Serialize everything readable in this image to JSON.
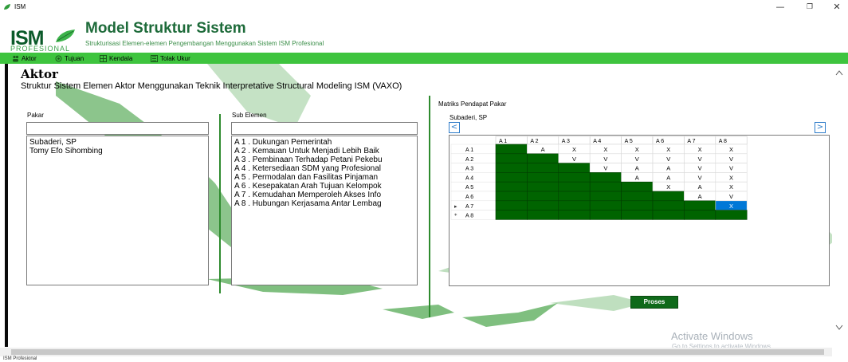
{
  "window": {
    "title": "ISM",
    "minimize": "—",
    "maximize": "❐",
    "close": "✕"
  },
  "header": {
    "logo": "ISM",
    "logo_sub": "PROFESIONAL",
    "title": "Model Struktur Sistem",
    "subtitle": "Strukturisasi Elemen-elemen Pengembangan Menggunakan Sistem ISM Profesional"
  },
  "menu": [
    {
      "label": "Aktor",
      "icon": "people-icon"
    },
    {
      "label": "Tujuan",
      "icon": "target-icon"
    },
    {
      "label": "Kendala",
      "icon": "grid-icon"
    },
    {
      "label": "Tolak Ukur",
      "icon": "ruler-icon"
    }
  ],
  "page": {
    "heading": "Aktor",
    "description": "Struktur Sistem Elemen Aktor  Menggunakan Teknik Interpretative Structural Modeling ISM (VAXO)"
  },
  "pakar": {
    "label": "Pakar",
    "search_value": "",
    "items": [
      "Subaderi, SP",
      "Tomy Efo Sihombing"
    ]
  },
  "sub_elemen": {
    "label": "Sub Elemen",
    "search_value": "",
    "items": [
      "A 1 . Dukungan Pemerintah",
      "A 2 . Kemauan Untuk Menjadi Lebih Baik",
      "A 3 . Pembinaan Terhadap Petani Pekebu",
      "A 4 . Ketersediaan SDM yang Profesional",
      "A 5 . Permodalan dan Fasilitas Pinjaman",
      "A 6 . Kesepakatan Arah Tujuan Kelompok",
      "A 7 . Kemudahan Memperoleh Akses Info",
      "A 8 . Hubungan Kerjasama Antar Lembag"
    ]
  },
  "matrix": {
    "label": "Matriks Pendapat Pakar",
    "expert": "Subaderi, SP",
    "prev": "<",
    "next": ">",
    "columns": [
      "A 1",
      "A 2",
      "A 3",
      "A 4",
      "A 5",
      "A 6",
      "A 7",
      "A 8"
    ],
    "rows": [
      {
        "marker": "",
        "label": "A 1",
        "cells": [
          "",
          "A",
          "X",
          "X",
          "X",
          "X",
          "X",
          "X"
        ]
      },
      {
        "marker": "",
        "label": "A 2",
        "cells": [
          "",
          "",
          "V",
          "V",
          "V",
          "V",
          "V",
          "V"
        ]
      },
      {
        "marker": "",
        "label": "A 3",
        "cells": [
          "",
          "",
          "",
          "V",
          "A",
          "A",
          "V",
          "V"
        ]
      },
      {
        "marker": "",
        "label": "A 4",
        "cells": [
          "",
          "",
          "",
          "",
          "A",
          "A",
          "V",
          "X"
        ]
      },
      {
        "marker": "",
        "label": "A 5",
        "cells": [
          "",
          "",
          "",
          "",
          "",
          "X",
          "A",
          "X"
        ]
      },
      {
        "marker": "",
        "label": "A 6",
        "cells": [
          "",
          "",
          "",
          "",
          "",
          "",
          "A",
          "V"
        ]
      },
      {
        "marker": "▸",
        "label": "A 7",
        "cells": [
          "",
          "",
          "",
          "",
          "",
          "",
          "",
          "X"
        ]
      },
      {
        "marker": "*",
        "label": "A 8",
        "cells": [
          "",
          "",
          "",
          "",
          "",
          "",
          "",
          ""
        ]
      }
    ],
    "selected": {
      "row": 6,
      "col": 7
    }
  },
  "proses_label": "Proses",
  "watermark": {
    "line1": "Activate Windows",
    "line2": "Go to Settings to activate Windows."
  },
  "status": "ISM Profesional",
  "colors": {
    "menu_green": "#3ec43e",
    "cell_green": "#006400",
    "selected_blue": "#0078d7",
    "button_green": "#0f6a1a"
  }
}
